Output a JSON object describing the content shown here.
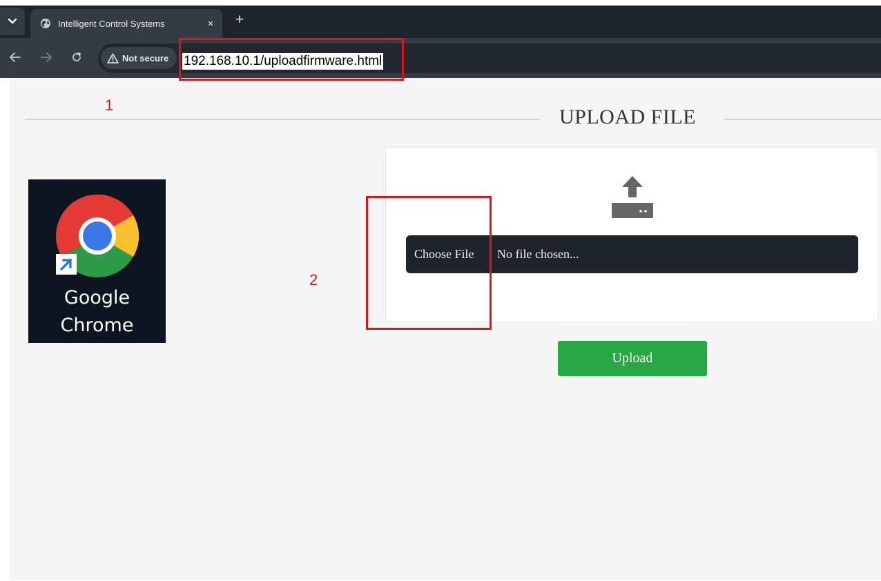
{
  "browser": {
    "tab_title": "Intelligent Control Systems",
    "tab_close_glyph": "×",
    "new_tab_glyph": "+",
    "security_label": "Not secure",
    "url": "192.168.10.1/uploadfirmware.html",
    "icons": {
      "tab_menu": "chevron-down-icon",
      "tab_favicon": "globe-icon",
      "back": "arrow-left-icon",
      "forward": "arrow-right-icon",
      "reload": "reload-icon",
      "security": "warning-icon"
    }
  },
  "page": {
    "title": "UPLOAD FILE",
    "upload_icon": "upload-icon",
    "file_input": {
      "button_label": "Choose File",
      "status": "No file chosen..."
    },
    "upload_button_label": "Upload"
  },
  "annotations": {
    "label_1": "1",
    "label_2": "2",
    "color": "#d21b1b"
  },
  "desktop_shortcut": {
    "name_line1": "Google",
    "name_line2": "Chrome",
    "icon": "google-chrome-icon",
    "badge_icon": "shortcut-arrow-icon"
  },
  "colors": {
    "upload_button": "#28a745",
    "file_bar": "#1f232b",
    "page_background": "#f5f5f5"
  }
}
